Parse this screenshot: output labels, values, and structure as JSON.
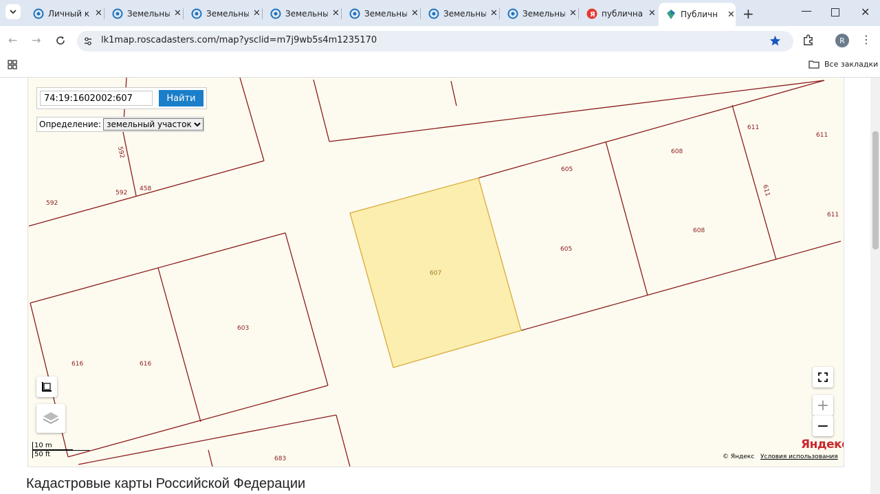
{
  "tabs": [
    {
      "title": "Личный к",
      "icon": "rosreestr-icon",
      "active": false
    },
    {
      "title": "Земельны",
      "icon": "rosreestr-icon",
      "active": false
    },
    {
      "title": "Земельны",
      "icon": "rosreestr-icon",
      "active": false
    },
    {
      "title": "Земельны",
      "icon": "rosreestr-icon",
      "active": false
    },
    {
      "title": "Земельны",
      "icon": "rosreestr-icon",
      "active": false
    },
    {
      "title": "Земельны",
      "icon": "rosreestr-icon",
      "active": false
    },
    {
      "title": "Земельны",
      "icon": "rosreestr-icon",
      "active": false
    },
    {
      "title": "публична",
      "icon": "yandex-icon",
      "active": false
    },
    {
      "title": "Публичн",
      "icon": "map-icon",
      "active": true
    }
  ],
  "browser": {
    "url": "lk1map.roscadasters.com/map?ysclid=m7j9wb5s4m1235170",
    "bookmarks_label": "Все закладки",
    "profile_initial": "R"
  },
  "search": {
    "value": "74:19:1602002:607",
    "button": "Найти",
    "definition_label": "Определение:",
    "definition_value": "земельный участок"
  },
  "map": {
    "parcel_labels": [
      "592",
      "592",
      "592",
      "458",
      "603",
      "616",
      "616",
      "683",
      "607",
      "605",
      "605",
      "608",
      "608",
      "611",
      "611",
      "611",
      "611"
    ],
    "selected_parcel": "607",
    "scale_m": "10 m",
    "scale_ft": "50 ft",
    "copyright": "© Яндекс",
    "terms": "Условия использования",
    "logo": "Яндекс",
    "highlight_color": "#fbeeae",
    "border_color": "#8b1a1a"
  },
  "page": {
    "heading": "Кадастровые карты Российской Федерации"
  }
}
